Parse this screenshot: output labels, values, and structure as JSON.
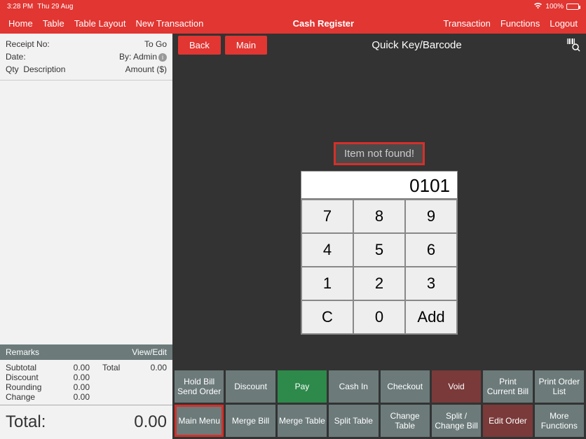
{
  "status": {
    "time": "3:28 PM",
    "date": "Thu 29 Aug",
    "battery": "100%"
  },
  "header": {
    "left": [
      "Home",
      "Table",
      "Table Layout",
      "New Transaction"
    ],
    "center": "Cash Register",
    "right": [
      "Transaction",
      "Functions",
      "Logout"
    ]
  },
  "receipt": {
    "row1L": "Receipt No:",
    "row1R": "To Go",
    "row2L": "Date:",
    "row2R": "By: Admin",
    "colQty": "Qty",
    "colDesc": "Description",
    "colAmt": "Amount ($)",
    "remarks": "Remarks",
    "viewEdit": "View/Edit",
    "subtotalL": "Subtotal",
    "subtotalV": "0.00",
    "totalL": "Total",
    "totalV": "0.00",
    "discountL": "Discount",
    "discountV": "0.00",
    "roundingL": "Rounding",
    "roundingV": "0.00",
    "changeL": "Change",
    "changeV": "0.00",
    "grandL": "Total:",
    "grandV": "0.00"
  },
  "topbar": {
    "back": "Back",
    "main": "Main",
    "title": "Quick Key/Barcode"
  },
  "keypad": {
    "error": "Item not found!",
    "display": "0101",
    "keys": [
      "7",
      "8",
      "9",
      "4",
      "5",
      "6",
      "1",
      "2",
      "3",
      "C",
      "0",
      "Add"
    ]
  },
  "fnRow1": [
    "Hold Bill Send Order",
    "Discount",
    "Pay",
    "Cash In",
    "Checkout",
    "Void",
    "Print Current Bill",
    "Print Order List"
  ],
  "fnRow2": [
    "Main Menu",
    "Merge Bill",
    "Merge Table",
    "Split Table",
    "Change Table",
    "Split / Change Bill",
    "Edit Order",
    "More Functions"
  ]
}
